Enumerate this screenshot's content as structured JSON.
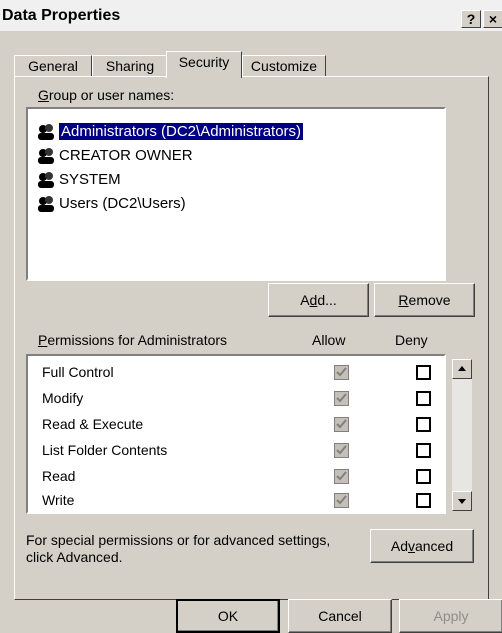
{
  "window": {
    "title": "Data Properties",
    "help": "?",
    "close": "×"
  },
  "tabs": [
    "General",
    "Sharing",
    "Security",
    "Customize"
  ],
  "group_label": {
    "pre": "",
    "ul": "G",
    "post": "roup or user names:"
  },
  "users": [
    "Administrators (DC2\\Administrators)",
    "CREATOR OWNER",
    "SYSTEM",
    "Users (DC2\\Users)"
  ],
  "buttons": {
    "add": {
      "pre": "A",
      "ul": "d",
      "post": "d..."
    },
    "remove": {
      "pre": "",
      "ul": "R",
      "post": "emove"
    },
    "advanced": {
      "pre": "Ad",
      "ul": "v",
      "post": "anced"
    },
    "ok": "OK",
    "cancel": "Cancel",
    "apply": "Apply"
  },
  "permissions": {
    "label": {
      "pre": "",
      "ul": "P",
      "post": "ermissions for Administrators"
    },
    "allow_header": "Allow",
    "deny_header": "Deny",
    "rows": [
      {
        "name": "Full Control",
        "allow": true,
        "deny": false
      },
      {
        "name": "Modify",
        "allow": true,
        "deny": false
      },
      {
        "name": "Read & Execute",
        "allow": true,
        "deny": false
      },
      {
        "name": "List Folder Contents",
        "allow": true,
        "deny": false
      },
      {
        "name": "Read",
        "allow": true,
        "deny": false
      },
      {
        "name": "Write",
        "allow": true,
        "deny": false
      }
    ]
  },
  "advanced_text": {
    "line1": "For special permissions or for advanced settings,",
    "line2": "click Advanced."
  },
  "colors": {
    "selection": "#000080",
    "face": "#d4d0c8"
  }
}
